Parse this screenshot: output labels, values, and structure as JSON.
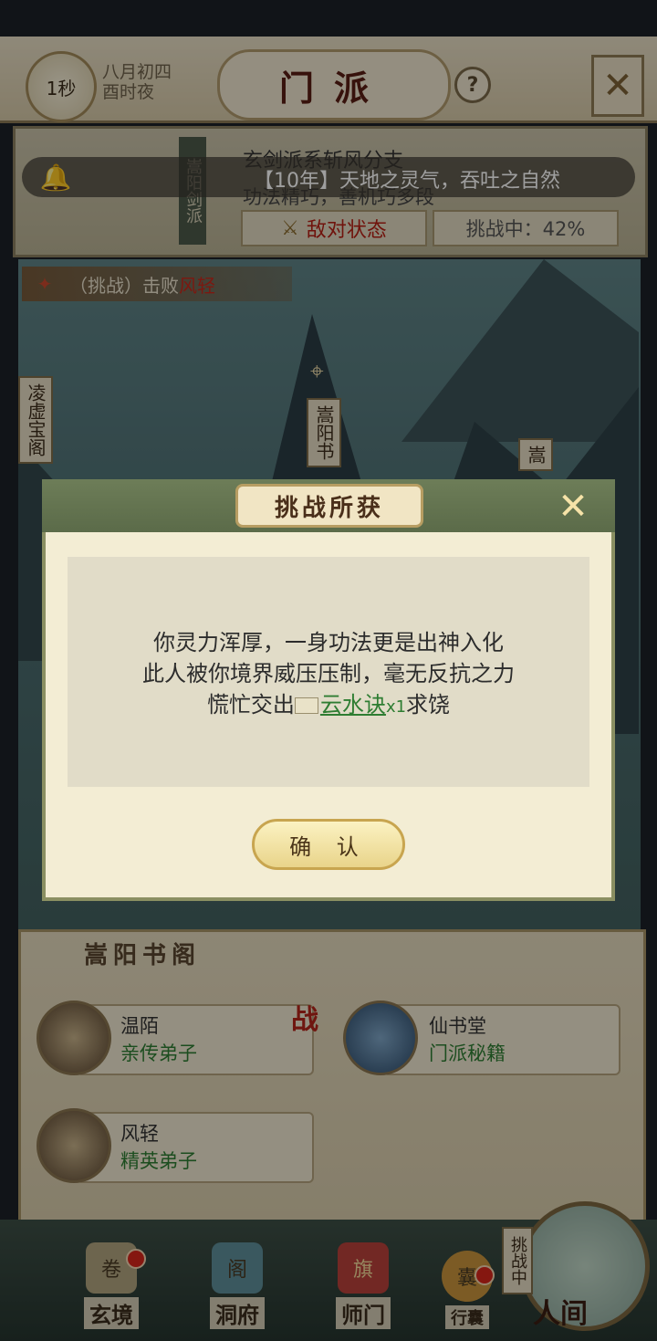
{
  "header": {
    "timer": "1秒",
    "date_line1": "八月初四",
    "date_line2": "酉时夜",
    "title": "门派",
    "help": "?",
    "close": "✕"
  },
  "info_panel": {
    "sect_vertical": "嵩阳剑派",
    "sect_name": "玄剑派系斩风分支",
    "sect_desc": "功法精巧，善机巧多段",
    "hostile_label": "敌对状态",
    "challenge_label": "挑战中：42%",
    "challenge_progress_percent": 42
  },
  "marquee": {
    "text": "【10年】天地之灵气，吞吐之自然"
  },
  "task": {
    "prefix": "（挑战）击败",
    "target": "风轻"
  },
  "map_signs": {
    "left": "凌虚宝阁",
    "center": "嵩阳书",
    "right": "嵩"
  },
  "dialog": {
    "title": "挑战所获",
    "line1": "你灵力浑厚，一身功法更是出神入化",
    "line2": "此人被你境界威压压制，毫无反抗之力",
    "line3_prefix": "慌忙交出",
    "reward_item": "云水诀",
    "reward_count": "x1",
    "line3_suffix": "求饶",
    "confirm": "确 认"
  },
  "pavilion": {
    "title": "嵩阳书阁",
    "battle_badge": "战",
    "cards": [
      {
        "name": "温陌",
        "role": "亲传弟子"
      },
      {
        "name": "仙书堂",
        "role": "门派秘籍"
      },
      {
        "name": "风轻",
        "role": "精英弟子"
      }
    ]
  },
  "nav": {
    "items": [
      {
        "label": "玄境"
      },
      {
        "label": "洞府"
      },
      {
        "label": "师门"
      },
      {
        "label": "行囊"
      }
    ],
    "world_tag": "挑战中",
    "world_label": "人间"
  },
  "colors": {
    "accent_red": "#b51f14",
    "reward_green": "#2e7d32",
    "dialog_header": "#5b6b49"
  }
}
